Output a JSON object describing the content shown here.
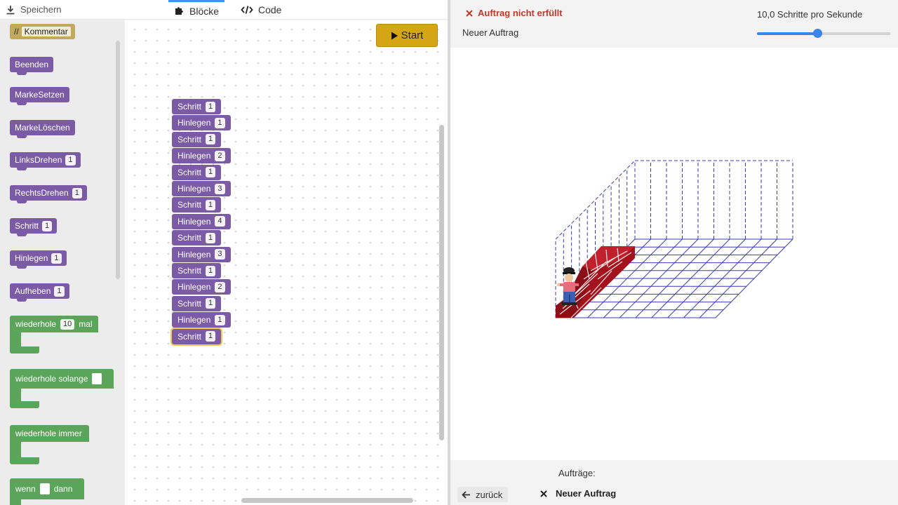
{
  "header": {
    "save_label": "Speichern",
    "tab_blocks": "Blöcke",
    "tab_code": "Code"
  },
  "toolbox": {
    "comment": {
      "prefix": "//",
      "label": "Kommentar"
    },
    "blocks": [
      {
        "label": "Beenden"
      },
      {
        "label": "MarkeSetzen"
      },
      {
        "label": "MarkeLöschen"
      },
      {
        "label": "LinksDrehen",
        "num": "1"
      },
      {
        "label": "RechtsDrehen",
        "num": "1"
      },
      {
        "label": "Schritt",
        "num": "1"
      },
      {
        "label": "Hinlegen",
        "num": "1"
      },
      {
        "label": "Aufheben",
        "num": "1"
      }
    ],
    "repeat_n": {
      "label": "wiederhole",
      "num": "10",
      "suffix": "mal"
    },
    "repeat_while": {
      "label": "wiederhole solange"
    },
    "repeat_forever": {
      "label": "wiederhole immer"
    },
    "if_then": {
      "label": "wenn",
      "suffix": "dann"
    }
  },
  "workspace": {
    "start_label": "Start",
    "program": [
      {
        "label": "Schritt",
        "num": "1"
      },
      {
        "label": "Hinlegen",
        "num": "1"
      },
      {
        "label": "Schritt",
        "num": "1"
      },
      {
        "label": "Hinlegen",
        "num": "2"
      },
      {
        "label": "Schritt",
        "num": "1"
      },
      {
        "label": "Hinlegen",
        "num": "3"
      },
      {
        "label": "Schritt",
        "num": "1"
      },
      {
        "label": "Hinlegen",
        "num": "4"
      },
      {
        "label": "Schritt",
        "num": "1"
      },
      {
        "label": "Hinlegen",
        "num": "3"
      },
      {
        "label": "Schritt",
        "num": "1"
      },
      {
        "label": "Hinlegen",
        "num": "2"
      },
      {
        "label": "Schritt",
        "num": "1"
      },
      {
        "label": "Hinlegen",
        "num": "1"
      },
      {
        "label": "Schritt",
        "num": "1"
      }
    ]
  },
  "panel": {
    "status": "Auftrag nicht erfüllt",
    "task_name": "Neuer Auftrag",
    "speed_label": "10,0 Schritte pro Sekunde",
    "speed_fraction": 0.45,
    "tasks_label": "Aufträge:",
    "back_label": "zurück",
    "task_items": [
      {
        "label": "Neuer Auftrag"
      }
    ]
  },
  "colors": {
    "motion_block": "#7c5ba6",
    "loop_block": "#5ba55b",
    "comment_block": "#c3a95b",
    "start_button": "#d4a514",
    "status_error": "#c0392b",
    "grid_line": "#3b3bb0",
    "brick": "#a3121d"
  },
  "icons": {
    "save": "download-icon",
    "blocks": "puzzle-icon",
    "code": "code-icon",
    "start": "play-icon",
    "status": "close-icon",
    "back": "arrow-left-icon"
  }
}
